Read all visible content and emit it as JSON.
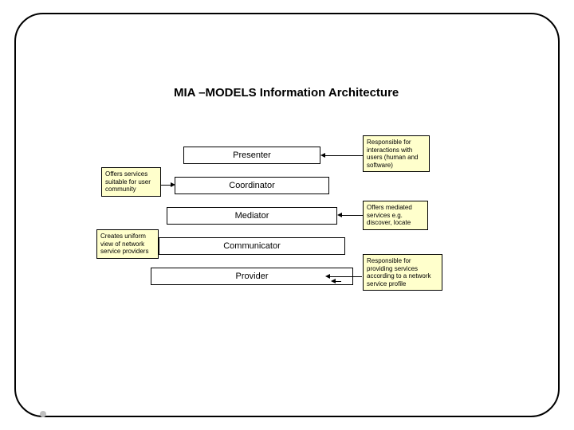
{
  "title": "MIA –MODELS Information Architecture",
  "layers": {
    "presenter": "Presenter",
    "coordinator": "Coordinator",
    "mediator": "Mediator",
    "communicator": "Communicator",
    "provider": "Provider"
  },
  "notes": {
    "presenter": "Responsible for interactions with users (human and software)",
    "coordinator": "Offers services suitable for user community",
    "mediator": "Offers mediated services e.g. discover, locate",
    "communicator": "Creates uniform view of network service providers",
    "provider": "Responsible for providing services according to a network service profile"
  }
}
